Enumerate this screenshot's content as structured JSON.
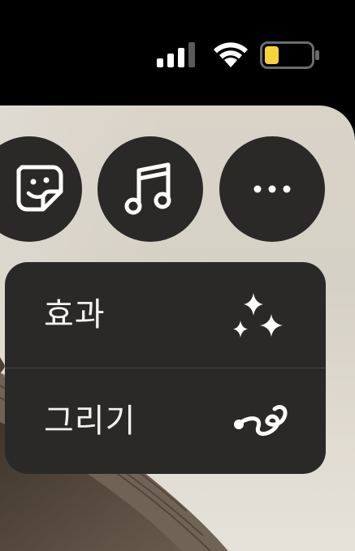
{
  "status_bar": {
    "signal_icon": "cellular-signal-icon",
    "wifi_icon": "wifi-icon",
    "battery_icon": "battery-icon",
    "battery_level": 0.2,
    "battery_color": "#f6d33c"
  },
  "action_buttons": [
    {
      "icon": "sticker-icon"
    },
    {
      "icon": "music-note-icon"
    },
    {
      "icon": "more-ellipsis-icon"
    }
  ],
  "menu": {
    "items": [
      {
        "label": "효과",
        "icon": "sparkles-icon"
      },
      {
        "label": "그리기",
        "icon": "draw-squiggle-icon"
      }
    ]
  },
  "colors": {
    "button_bg": "#2b2927",
    "text": "#f2f2f2",
    "background": "#000000"
  }
}
